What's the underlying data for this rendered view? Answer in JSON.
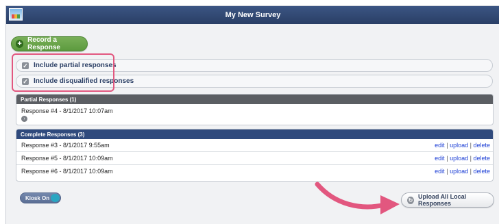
{
  "window": {
    "title": "My New Survey"
  },
  "actions": {
    "record_label": "Record a Response"
  },
  "options": [
    {
      "label": "Include partial responses",
      "checked": true
    },
    {
      "label": "Include disqualified responses",
      "checked": true
    }
  ],
  "partial_panel": {
    "header": "Partial Responses (1)",
    "rows": [
      {
        "label": "Response #4 - 8/1/2017 10:07am"
      }
    ]
  },
  "complete_panel": {
    "header": "Complete Responses (3)",
    "rows": [
      {
        "label": "Response #3 - 8/1/2017 9:55am",
        "edit": "edit",
        "upload": "upload",
        "delete": "delete"
      },
      {
        "label": "Response #5 - 8/1/2017 10:09am",
        "edit": "edit",
        "upload": "upload",
        "delete": "delete"
      },
      {
        "label": "Response #6 - 8/1/2017 10:09am",
        "edit": "edit",
        "upload": "upload",
        "delete": "delete"
      }
    ],
    "separator": "|"
  },
  "kiosk": {
    "label": "Kiosk On",
    "on": true
  },
  "upload": {
    "label": "Upload All Local Responses"
  },
  "colors": {
    "titlebar": "#2f4a7d",
    "record_button": "#6aa34a",
    "highlight": "#e2577f",
    "link": "#1e40d6",
    "kiosk_toggle": "#2aa6c2"
  },
  "icons": [
    "app-icon",
    "plus-icon",
    "checkbox-icon",
    "arrow-circle-icon",
    "upload-icon",
    "callout-arrow-icon"
  ]
}
